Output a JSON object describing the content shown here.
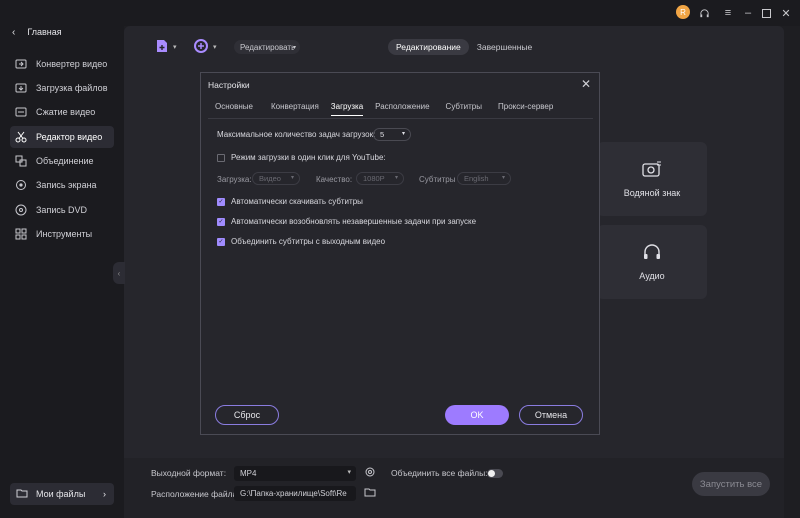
{
  "window": {
    "avatar_initial": "R",
    "controls": [
      "headset-icon",
      "menu-icon",
      "minimize-icon",
      "maximize-icon",
      "close-icon"
    ]
  },
  "sidebar": {
    "home": "Главная",
    "items": [
      {
        "label": "Конвертер видео",
        "icon": "video-convert-icon",
        "active": false
      },
      {
        "label": "Загрузка файлов",
        "icon": "download-icon",
        "active": false
      },
      {
        "label": "Сжатие видео",
        "icon": "compress-icon",
        "active": false
      },
      {
        "label": "Редактор видео",
        "icon": "scissors-icon",
        "active": true
      },
      {
        "label": "Объединение",
        "icon": "merge-icon",
        "active": false
      },
      {
        "label": "Запись экрана",
        "icon": "screen-record-icon",
        "active": false
      },
      {
        "label": "Запись DVD",
        "icon": "dvd-icon",
        "active": false
      },
      {
        "label": "Инструменты",
        "icon": "tools-icon",
        "active": false
      }
    ],
    "my_files": "Мои файлы"
  },
  "main": {
    "edit_dropdown": "Редактировать",
    "tabs": [
      "Редактирование",
      "Завершенные"
    ],
    "tiles": [
      {
        "label": "Водяной знак",
        "icon": "watermark-icon"
      },
      {
        "label": "Аудио",
        "icon": "headphones-icon"
      }
    ]
  },
  "bottombar": {
    "output_format_label": "Выходной формат:",
    "output_format_value": "MP4",
    "merge_label": "Объединить все файлы:",
    "location_label": "Расположение файла:",
    "location_value": "G:\\Папка-хранилище\\Soft\\Re",
    "start_button": "Запустить все"
  },
  "dialog": {
    "title": "Настройки",
    "tabs": [
      "Основные",
      "Конвертация",
      "Загрузка",
      "Расположение",
      "Субтитры",
      "Прокси-сервер"
    ],
    "active_tab": "Загрузка",
    "max_tasks_label": "Максимальное количество задач загрузок:",
    "max_tasks_value": "5",
    "one_click_label": "Режим загрузки в один клик для YouTube:",
    "download_label": "Загрузка:",
    "download_value": "Видео",
    "quality_label": "Качество:",
    "quality_value": "1080P",
    "subtitles_label": "Субтитры",
    "subtitles_value": "English",
    "checkbox_auto_subs": "Автоматически скачивать субтитры",
    "checkbox_resume": "Автоматически возобновлять незавершенные задачи при запуске",
    "checkbox_merge_subs": "Объединить субтитры с выходным видео",
    "reset_button": "Сброс",
    "ok_button": "OK",
    "cancel_button": "Отмена"
  },
  "colors": {
    "accent": "#9d7bff",
    "background": "#1e1e22",
    "panel": "#26262c"
  }
}
